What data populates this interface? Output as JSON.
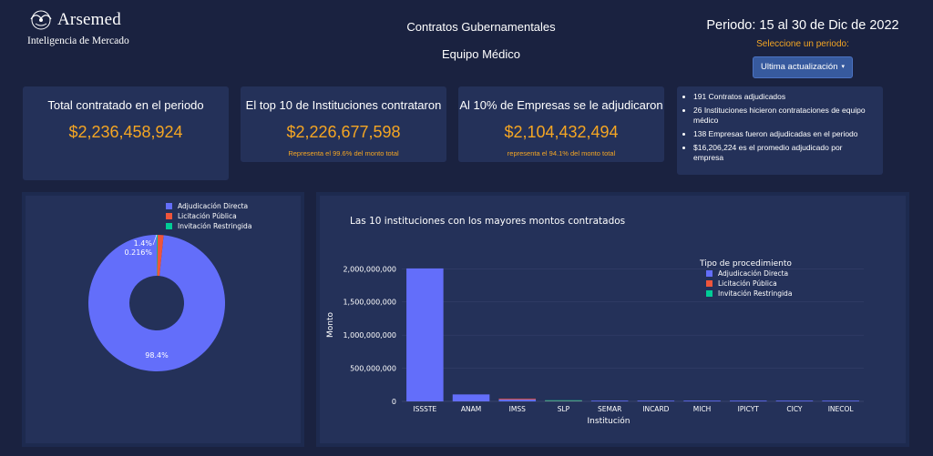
{
  "brand": {
    "name": "Arsemed",
    "subtitle": "Inteligencia de Mercado"
  },
  "header": {
    "line1": "Contratos Gubernamentales",
    "line2": "Equipo Médico"
  },
  "period": {
    "title": "Periodo: 15 al 30 de Dic de 2022",
    "prompt": "Seleccione un periodo:",
    "dropdown_label": "Ultima actualización"
  },
  "kpis": [
    {
      "title": "Total contratado en el periodo",
      "value": "$2,236,458,924",
      "note": ""
    },
    {
      "title": "El top 10 de Instituciones contrataron",
      "value": "$2,226,677,598",
      "note": "Representa el 99.6% del monto total"
    },
    {
      "title": "Al 10% de Empresas se le adjudicaron",
      "value": "$2,104,432,494",
      "note": "representa el 94.1% del monto total"
    }
  ],
  "summary": [
    "191 Contratos adjudicados",
    "26 Instituciones hicieron contrataciones de equipo médico",
    "138 Empresas fueron adjudicadas en el periodo",
    "$16,206,224 es el promedio adjudicado por empresa"
  ],
  "colors": {
    "directa": "#636efa",
    "publica": "#ef553b",
    "restringida": "#00cc96",
    "accent": "#f5a623"
  },
  "chart_data": [
    {
      "type": "pie",
      "hole": 0.4,
      "title": "",
      "legend_placement": "top-right",
      "categories": [
        "Adjudicación Directa",
        "Licitación Pública",
        "Invitación Restringida"
      ],
      "values": [
        98.4,
        1.4,
        0.216
      ],
      "labels": [
        "98.4%",
        "1.4%",
        "0.216%"
      ]
    },
    {
      "type": "bar",
      "title": "Las 10 instituciones con los mayores montos contratados",
      "xlabel": "Institución",
      "ylabel": "Monto",
      "legend_title": "Tipo de procedimiento",
      "legend_placement": "top-right",
      "grid": true,
      "barmode": "stack",
      "ylim": [
        0,
        2100000000
      ],
      "yticks": [
        0,
        500000000,
        1000000000,
        1500000000,
        2000000000
      ],
      "ytick_labels": [
        "0",
        "500,000,000",
        "1,000,000,000",
        "1,500,000,000",
        "2,000,000,000"
      ],
      "categories": [
        "ISSSTE",
        "ANAM",
        "IMSS",
        "SLP",
        "SEMAR",
        "INCARD",
        "MICH",
        "IPICYT",
        "CICY",
        "INECOL"
      ],
      "series": [
        {
          "name": "Adjudicación Directa",
          "values": [
            2005000000,
            105000000,
            30000000,
            2000000,
            1500000,
            1000000,
            800000,
            600000,
            400000,
            300000
          ]
        },
        {
          "name": "Licitación Pública",
          "values": [
            0,
            0,
            12000000,
            4000000,
            0,
            0,
            0,
            0,
            0,
            0
          ]
        },
        {
          "name": "Invitación Restringida",
          "values": [
            0,
            0,
            0,
            3000000,
            0,
            0,
            0,
            0,
            0,
            0
          ]
        }
      ]
    }
  ]
}
